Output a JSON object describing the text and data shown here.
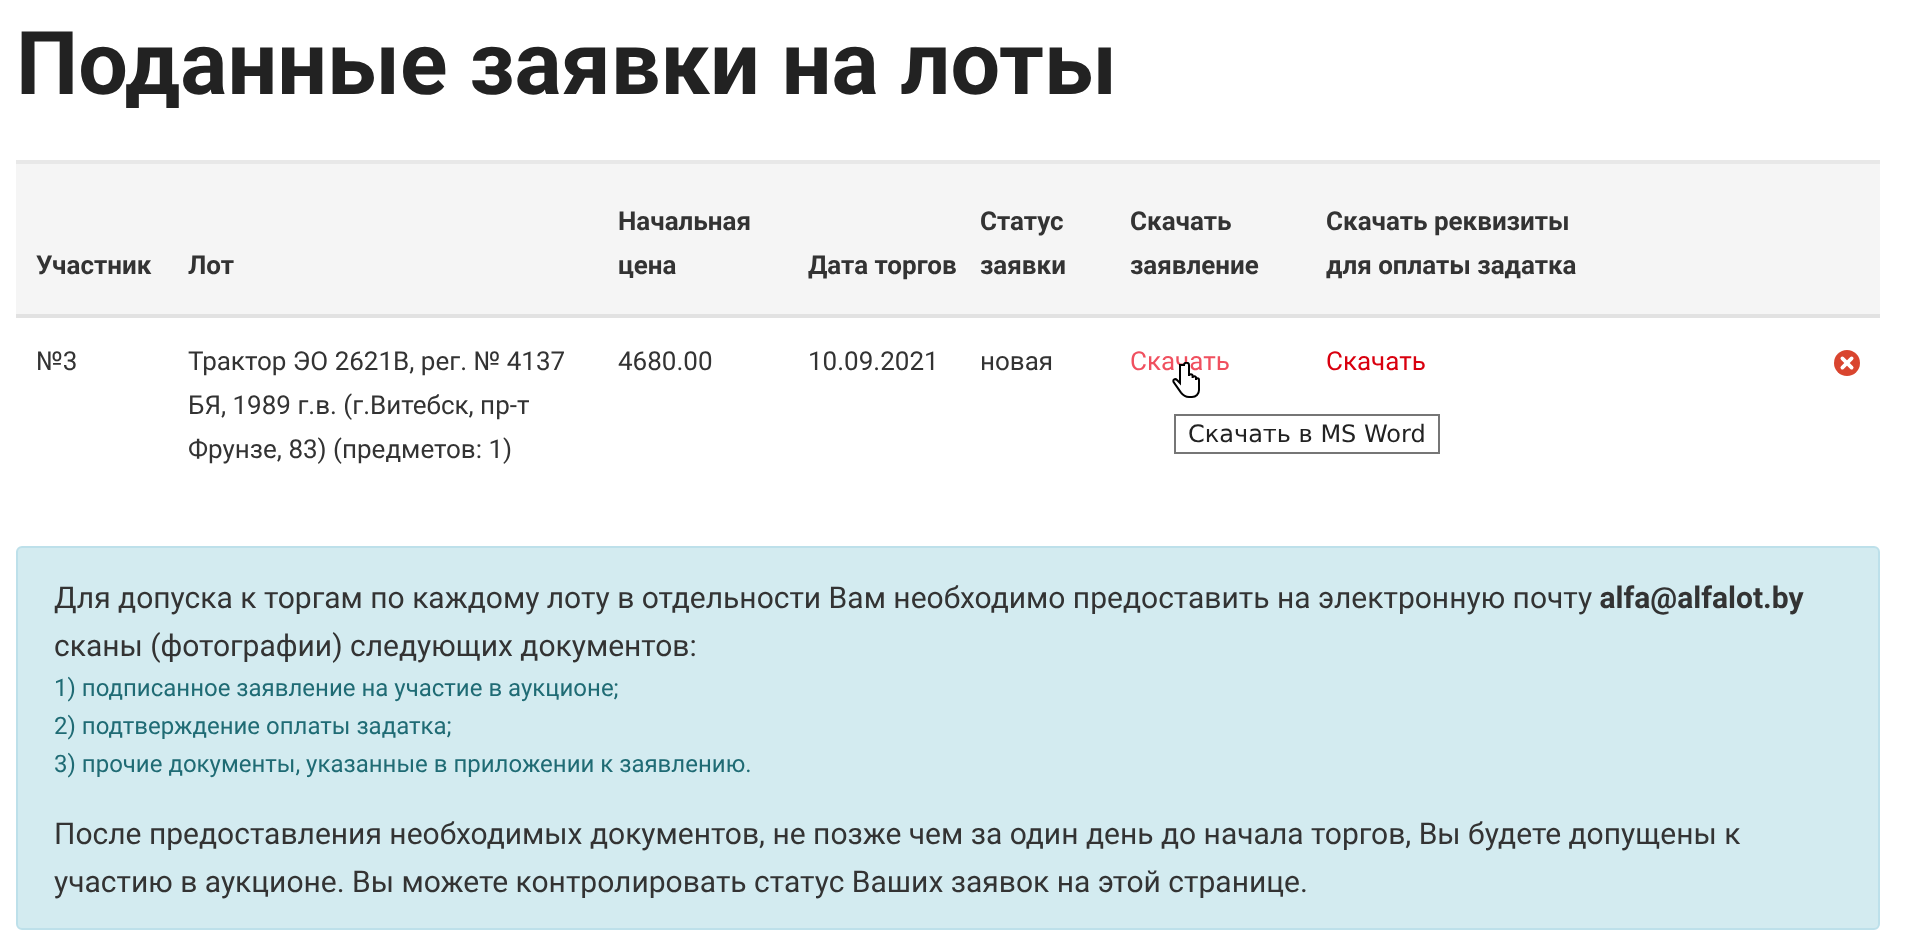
{
  "title": "Поданные заявки на лоты",
  "table": {
    "columns": [
      "Участник",
      "Лот",
      "Начальная цена",
      "Дата торгов",
      "Статус заявки",
      "Скачать заявление",
      "Скачать реквизиты для оплаты задатка"
    ],
    "rows": [
      {
        "participant": "№3",
        "lot": "Трактор ЭО 2621В, рег. № 4137 БЯ, 1989 г.в. (г.Витебск, пр-т Фрунзе, 83) (предметов: 1)",
        "price": "4680.00",
        "date": "10.09.2021",
        "status": "новая",
        "links": [
          {
            "label": "Скачать",
            "hovered": true,
            "tooltip": "Скачать в MS Word"
          },
          {
            "label": "Скачать",
            "hovered": false
          }
        ]
      }
    ]
  },
  "notice": {
    "intro": "Для допуска к торгам по каждому лоту в отдельности Вам необходимо предоставить на электронную почту **alfa@alfalot.by** сканы (фотографии) следующих документов:",
    "items": [
      "1) подписанное заявление на участие в аукционе;",
      "2) подтверждение оплаты задатка;",
      "3) прочие документы, указанные в приложении к заявлению."
    ],
    "outro": "После предоставления необходимых документов, не позже чем за один день до начала торгов, Вы будете допущены к участию в аукционе. Вы можете контролировать статус Ваших заявок на этой странице."
  }
}
